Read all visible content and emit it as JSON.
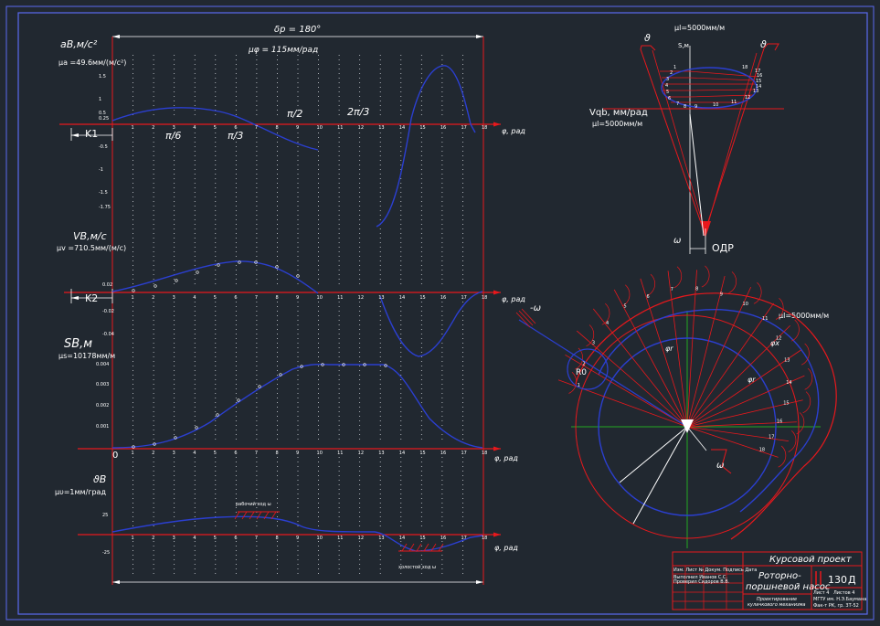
{
  "top_dimension": "δр = 180°",
  "mu_phi": "μφ = 115мм/рад",
  "accel": {
    "label": "aB,м/с²",
    "scale": "μa =49.6мм/(м/с²)",
    "angles": [
      "π/6",
      "π/3",
      "π/2",
      "2π/3"
    ],
    "k_label": "K1",
    "tick_values": [
      "1.5",
      "1",
      "0.5",
      "0.25",
      "-0.5",
      "-1",
      "-1.5",
      "-1.75"
    ]
  },
  "velocity": {
    "label": "VB,м/с",
    "scale": "μv =710.5мм/(м/с)",
    "k_label": "K2",
    "tick_values": [
      "0.02",
      "-0.02",
      "-0.04"
    ]
  },
  "displacement": {
    "label": "SB,м",
    "scale": "μs=10178мм/м",
    "tick_values": [
      "0.004",
      "0.003",
      "0.002",
      "0.001"
    ]
  },
  "angle": {
    "label": "ϑB",
    "scale": "μυ=1мм/град",
    "work_zone": "рабочий ход ω",
    "idle_zone": "холостой ход ω",
    "tick_values": [
      "25",
      "-25"
    ]
  },
  "axis_phi": "φ, рад",
  "zero": "0",
  "x_ticks": [
    "1",
    "2",
    "3",
    "4",
    "5",
    "6",
    "7",
    "8",
    "9",
    "10",
    "11",
    "12",
    "13",
    "14",
    "15",
    "16",
    "17",
    "18"
  ],
  "top_right": {
    "scale": "μl=5000мм/м",
    "s_axis": "S,м",
    "theta": "ϑ",
    "v_label": "Vqb, мм/рад",
    "v_scale": "μl=5000мм/м",
    "omega": "ω",
    "odr": "ОДР",
    "points": [
      "1",
      "2",
      "3",
      "4",
      "5",
      "6",
      "7",
      "8",
      "9",
      "10",
      "11",
      "12",
      "13",
      "14",
      "15",
      "16",
      "17",
      "18"
    ]
  },
  "cam": {
    "scale": "μl=5000мм/м",
    "omega_neg": "-ω",
    "omega": "ω",
    "r0": "R0",
    "phi_labels": [
      "φr",
      "φr",
      "φx"
    ],
    "points": [
      "1",
      "2",
      "3",
      "4",
      "5",
      "6",
      "7",
      "8",
      "9",
      "10",
      "11",
      "12",
      "13",
      "14",
      "15",
      "16",
      "17",
      "18"
    ]
  },
  "title_block": {
    "header": "Курсовой проект",
    "name_line1": "Роторно-",
    "name_line2": "поршневой насос",
    "subtitle_line1": "Проектирование",
    "subtitle_line2": "кулачкового механизма",
    "code": "130",
    "letter": "Д",
    "sheet": "Лист 4",
    "sheets": "Листов 4",
    "org1": "МГТУ им. Н.Э.Баумана",
    "org2": "Фак-т РК, гр. 3Т-52",
    "roles": [
      "Изм. Лист  № Докум.  Подпись  Дата",
      "Выполнил  Иванов С.С.",
      "Проверил  Сидоров В.В."
    ]
  },
  "colors": {
    "background": "#212830",
    "curve": "#2b3fd0",
    "construction": "#e8181c",
    "frame": "#4a5cff",
    "text": "#ffffff"
  }
}
